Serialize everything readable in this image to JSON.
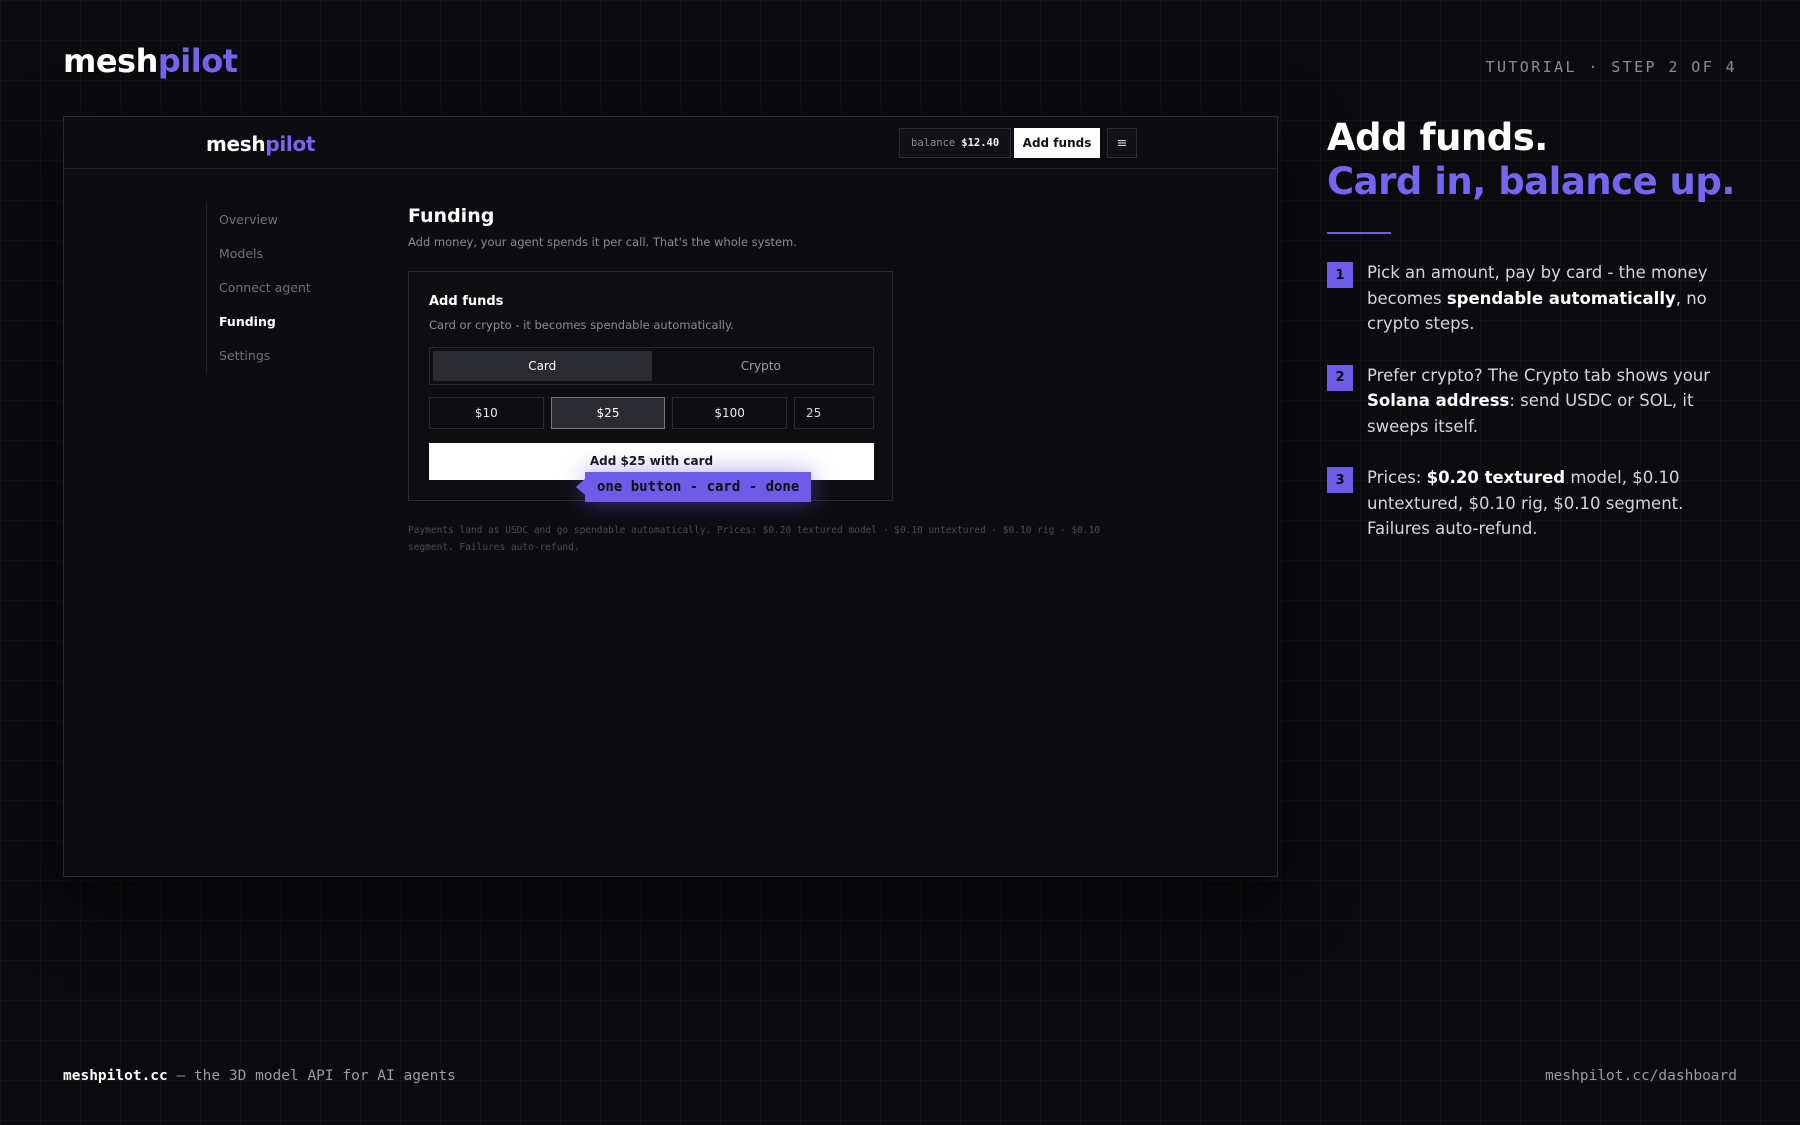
{
  "brand": {
    "part1": "mesh",
    "part2": "pilot"
  },
  "step_label": "TUTORIAL · STEP 2 OF 4",
  "app": {
    "logo": {
      "part1": "mesh",
      "part2": "pilot"
    },
    "header": {
      "balance_label": "balance",
      "balance_value": "$12.40",
      "add_funds_label": "Add funds",
      "menu_glyph": "≡"
    },
    "sidebar": {
      "items": [
        {
          "label": "Overview"
        },
        {
          "label": "Models"
        },
        {
          "label": "Connect agent"
        },
        {
          "label": "Funding"
        },
        {
          "label": "Settings"
        }
      ],
      "active": "Funding"
    },
    "page": {
      "title": "Funding",
      "subtitle": "Add money, your agent spends it per call. That's the whole system."
    },
    "add_funds_card": {
      "title": "Add funds",
      "description": "Card or crypto - it becomes spendable automatically.",
      "tabs": [
        {
          "label": "Card"
        },
        {
          "label": "Crypto"
        }
      ],
      "active_tab": "Card",
      "amounts": [
        {
          "label": "$10"
        },
        {
          "label": "$25"
        },
        {
          "label": "$100"
        }
      ],
      "selected_amount": "$25",
      "custom_amount_value": "25",
      "pay_button_label": "Add $25 with card"
    },
    "callout": "one button - card - done",
    "footnote": "Payments land as USDC and go spendable automatically. Prices: $0.20 textured model · $0.10 untextured · $0.10 rig · $0.10 segment. Failures auto-refund."
  },
  "panel": {
    "heading_line1": "Add funds.",
    "heading_line2": "Card in, balance up.",
    "steps": [
      {
        "num": "1",
        "t1": "Pick an amount, pay by card - the money becomes ",
        "bold": "spendable automatically",
        "t2": ", no crypto steps."
      },
      {
        "num": "2",
        "t1": "Prefer crypto? The Crypto tab shows your ",
        "bold": "Solana address",
        "t2": ": send USDC or SOL, it sweeps itself."
      },
      {
        "num": "3",
        "t1": "Prices: ",
        "bold": "$0.20 textured",
        "t2": " model, $0.10 untextured, $0.10 rig, $0.10 segment. Failures auto-refund."
      }
    ]
  },
  "footer": {
    "site": "meshpilot.cc",
    "tagline": " — the 3D model API for AI agents",
    "url": "meshpilot.cc/dashboard"
  },
  "colors": {
    "accent": "#6c5ce7",
    "background": "#0b0b0f"
  }
}
